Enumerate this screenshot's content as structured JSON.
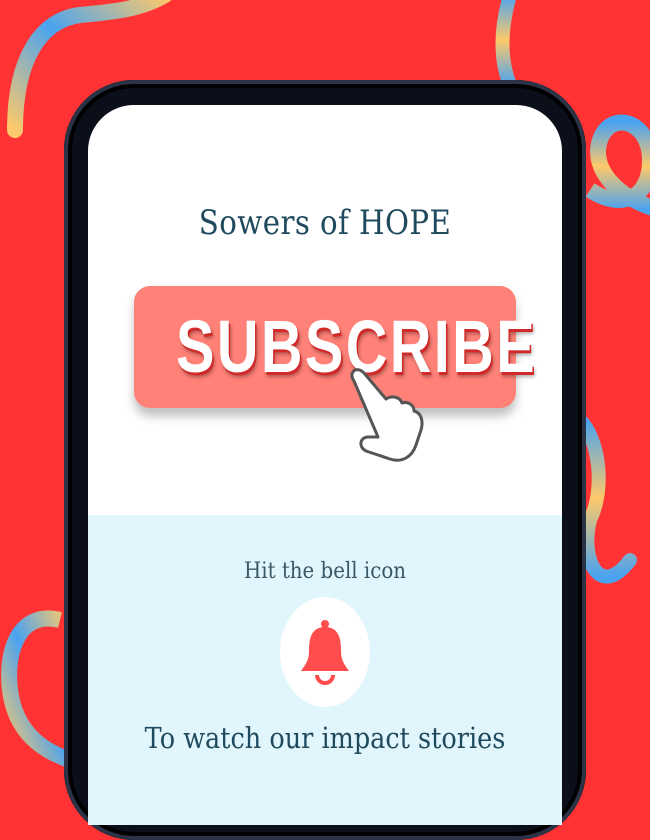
{
  "header": {
    "title": "Sowers of HOPE"
  },
  "subscribe": {
    "label": "SUBSCRIBE",
    "color": "#ff8177"
  },
  "bell_section": {
    "prompt": "Hit the bell icon",
    "icon": "bell-icon",
    "tagline": "To watch our impact stories",
    "background": "#e1f5fc"
  },
  "colors": {
    "background": "#ff3333",
    "title": "#1f4a5e",
    "bell": "#ff4d4d"
  }
}
